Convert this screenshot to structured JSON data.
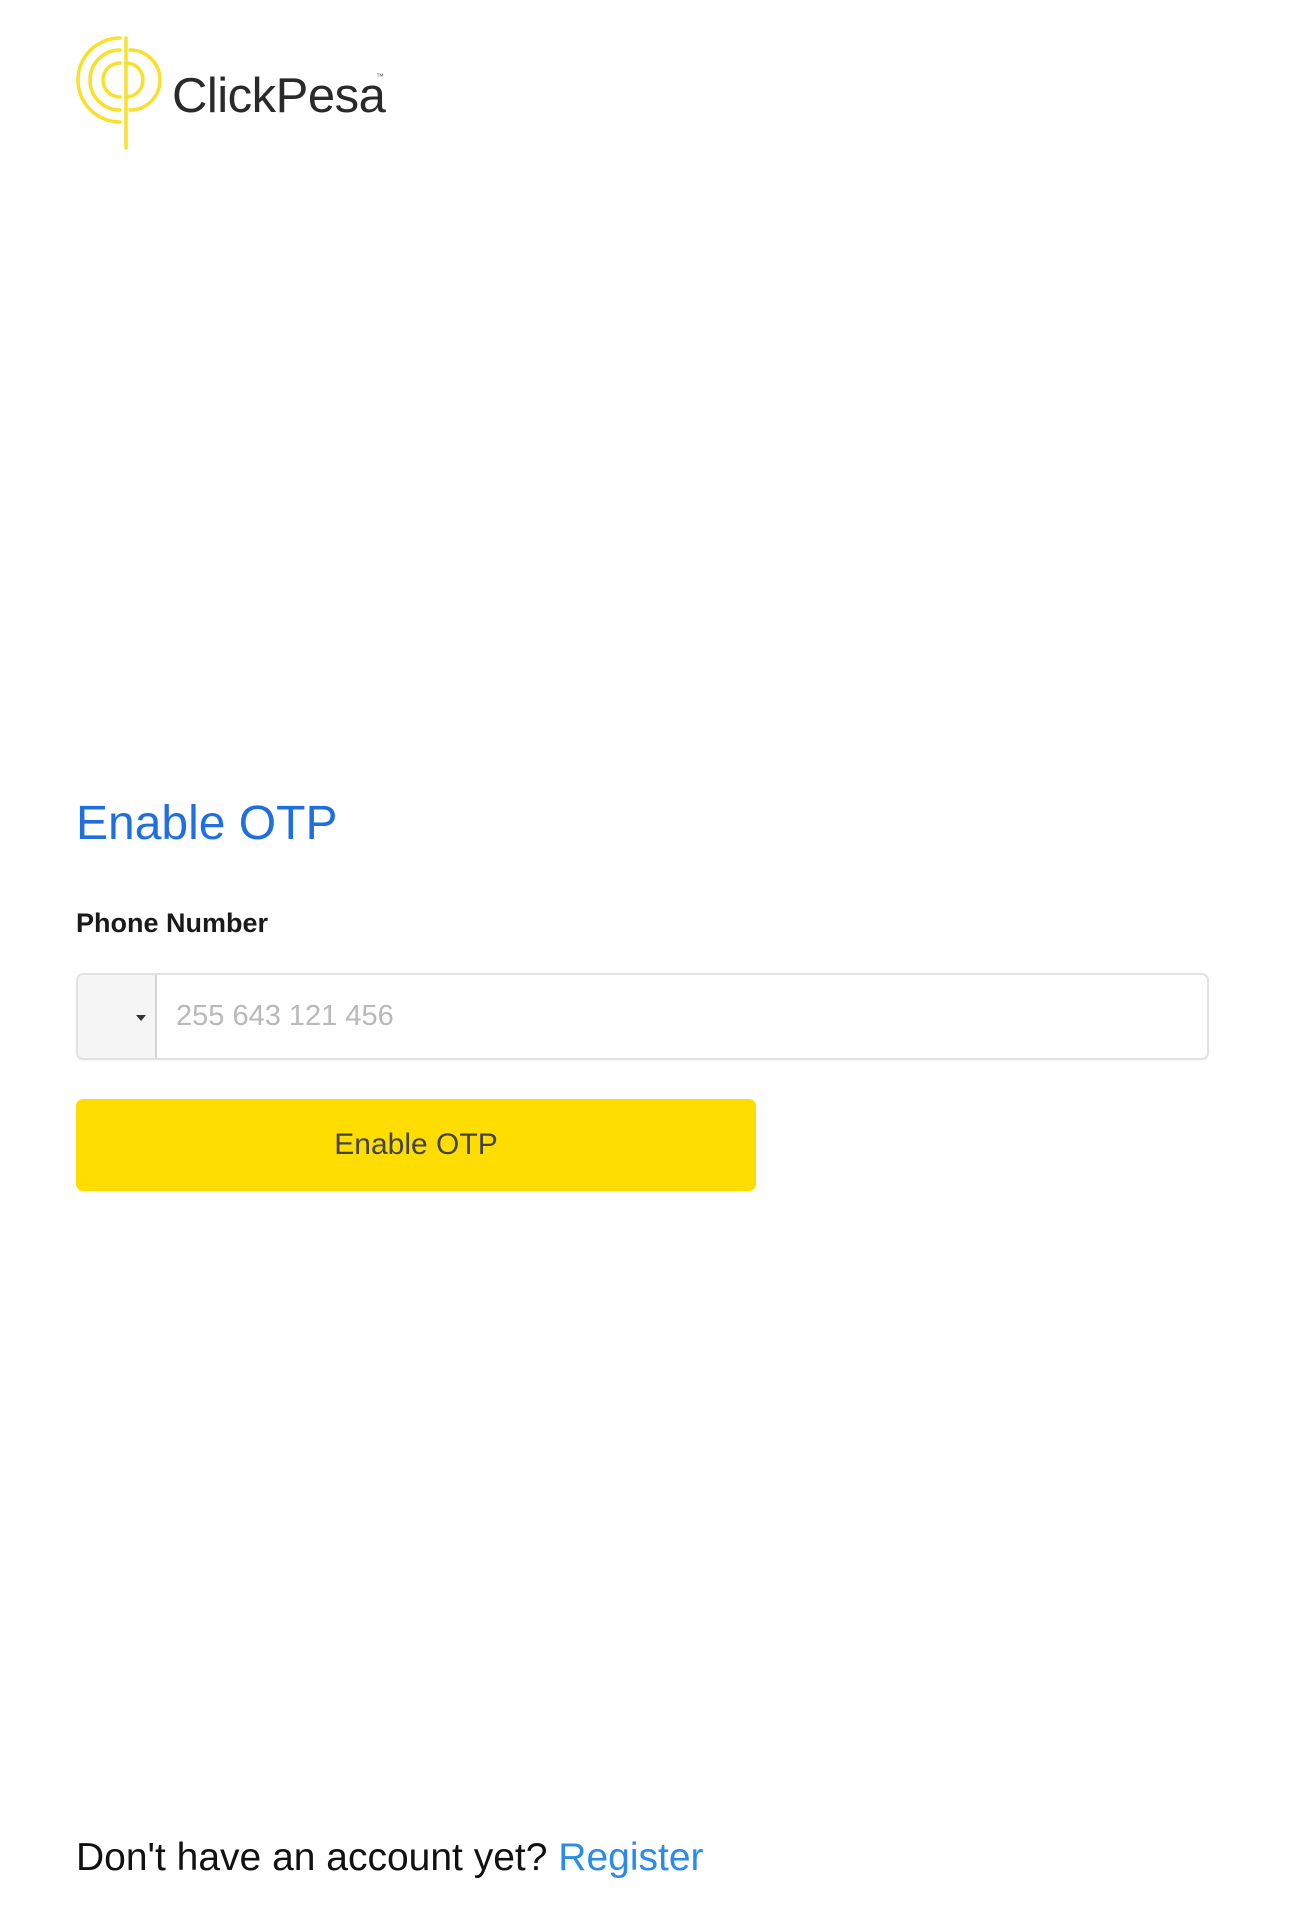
{
  "brand": {
    "name": "ClickPesa",
    "trademark": "™",
    "logo_color": "#f9e02a"
  },
  "form": {
    "title": "Enable OTP",
    "phone_label": "Phone Number",
    "phone_placeholder": "255 643 121 456",
    "phone_value": "",
    "country_code_selected": "",
    "submit_label": "Enable OTP"
  },
  "footer": {
    "prompt": "Don't have an account yet?",
    "register_label": "Register"
  },
  "colors": {
    "accent_title": "#1f6fde",
    "link": "#2a8be8",
    "button_bg": "#ffdd00"
  }
}
